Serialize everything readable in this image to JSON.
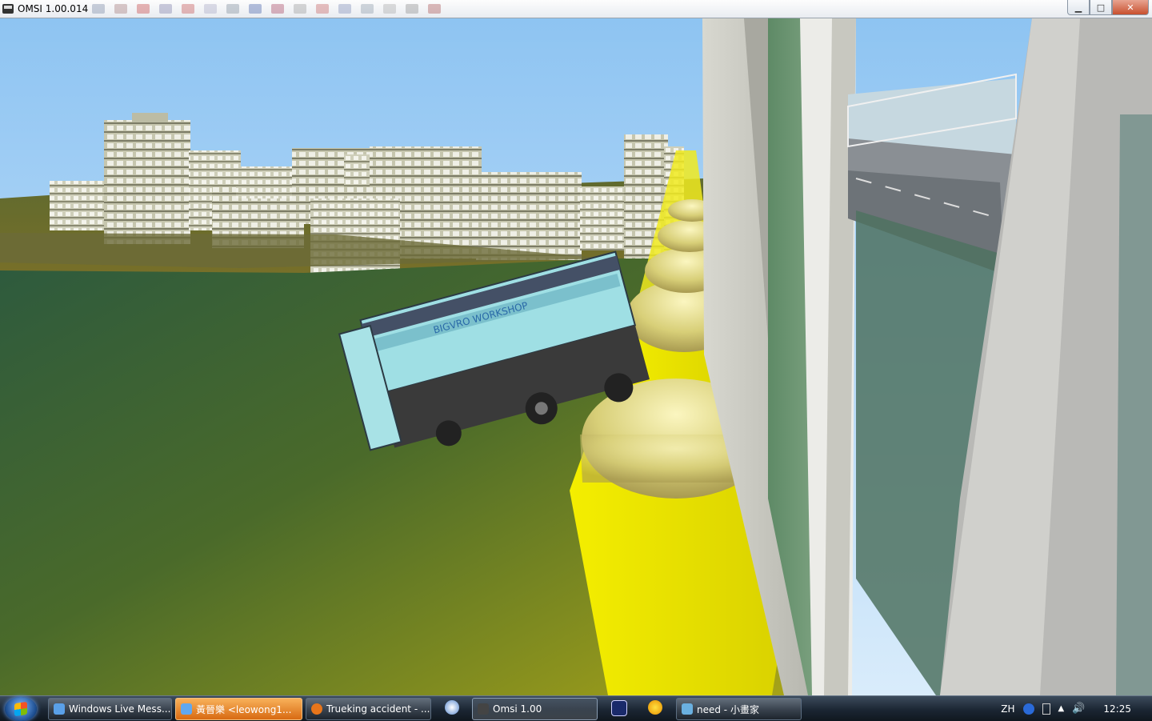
{
  "window": {
    "title": "OMSI 1.00.014",
    "controls": {
      "minimize": "▁",
      "maximize": "□",
      "close": "✕"
    }
  },
  "scene": {
    "bus_advert_text": "BIGVRO WORKSHOP"
  },
  "taskbar": {
    "tasks": [
      {
        "label": "Windows Live Mess...",
        "icon": "messenger-icon",
        "color": "#5aa0e8"
      },
      {
        "label": "黃晉樂 <leowong1...",
        "icon": "chat-window-icon",
        "color": "#60a8f0"
      },
      {
        "label": "Trueking accident - ...",
        "icon": "firefox-icon",
        "color": "#e8751a"
      },
      {
        "label": "Omsi 1.00",
        "icon": "omsi-bus-icon",
        "color": "#444444"
      },
      {
        "label": "need - 小畫家",
        "icon": "paint-icon",
        "color": "#6ab0e0"
      }
    ],
    "quick_icons": [
      "itunes-icon",
      "calculator-icon",
      "qq-icon"
    ],
    "tray": {
      "language": "ZH",
      "time": "12:25"
    }
  }
}
